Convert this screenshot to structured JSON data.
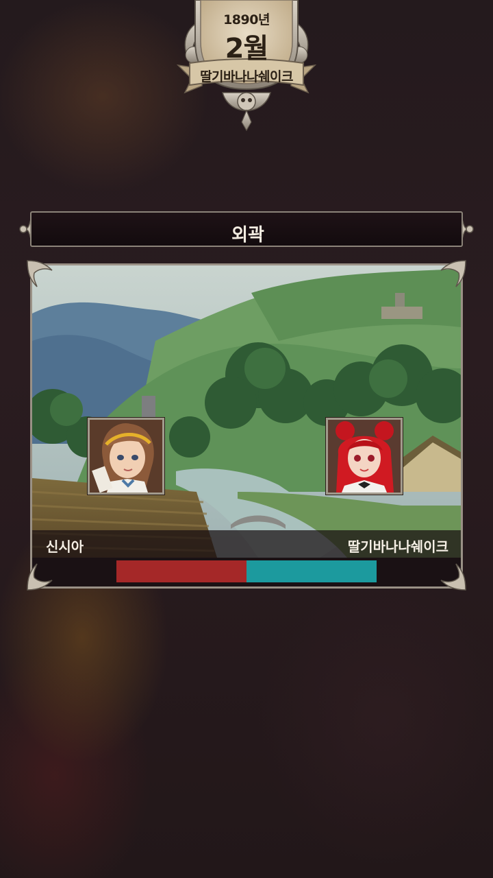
{
  "date_badge": {
    "year": "1890년",
    "month": "2월",
    "player_name": "딸기바나나쉐이크"
  },
  "location": {
    "title": "외곽"
  },
  "battle": {
    "left_name": "신시아",
    "right_name": "딸기바나나쉐이크",
    "left_share": 0.5,
    "right_share": 0.5,
    "left_color": "#a52828",
    "right_color": "#1c9a9e"
  },
  "icons": {
    "fleur_left": "fleur-de-lis-ornament-icon",
    "fleur_right": "fleur-de-lis-ornament-icon",
    "badge_skull": "skull-ornament-icon"
  }
}
